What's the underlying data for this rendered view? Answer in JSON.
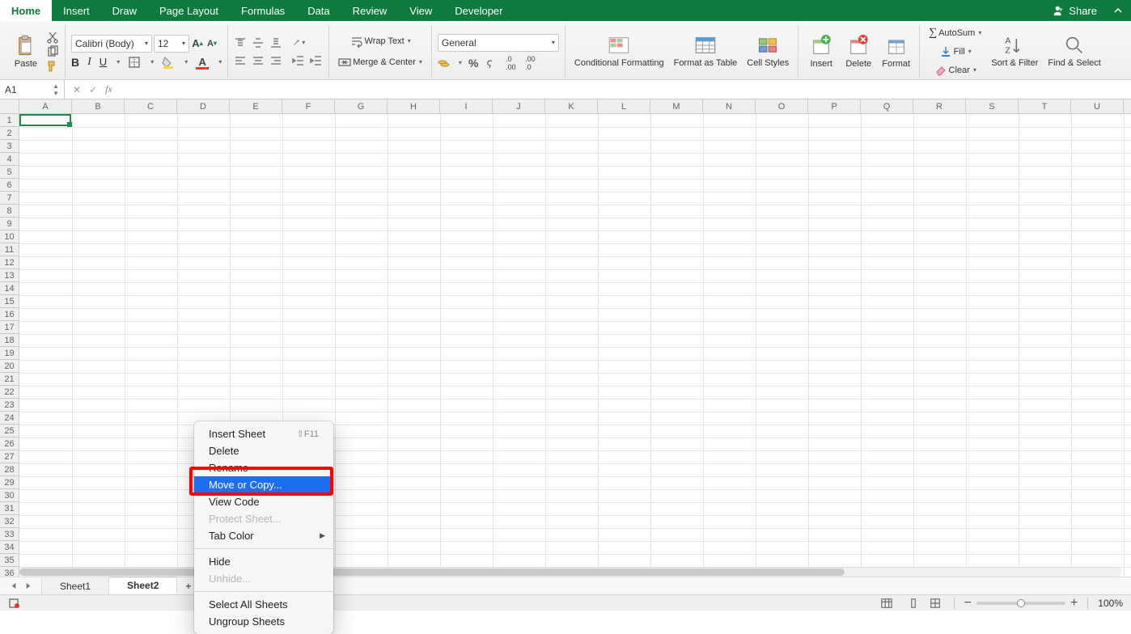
{
  "menubar": {
    "tabs": [
      "Home",
      "Insert",
      "Draw",
      "Page Layout",
      "Formulas",
      "Data",
      "Review",
      "View",
      "Developer"
    ],
    "active_tab": "Home",
    "share_label": "Share"
  },
  "ribbon": {
    "paste_label": "Paste",
    "font_name": "Calibri (Body)",
    "font_size": "12",
    "wrap_label": "Wrap Text",
    "merge_label": "Merge & Center",
    "number_format": "General",
    "cond_fmt": "Conditional Formatting",
    "fmt_table": "Format as Table",
    "cell_styles": "Cell Styles",
    "insert": "Insert",
    "delete": "Delete",
    "format": "Format",
    "autosum": "AutoSum",
    "fill": "Fill",
    "clear": "Clear",
    "sort_filter": "Sort & Filter",
    "find_select": "Find & Select"
  },
  "formula_bar": {
    "cell_ref": "A1",
    "formula": ""
  },
  "sheet": {
    "columns": [
      "A",
      "B",
      "C",
      "D",
      "E",
      "F",
      "G",
      "H",
      "I",
      "J",
      "K",
      "L",
      "M",
      "N",
      "O",
      "P",
      "Q",
      "R",
      "S",
      "T",
      "U"
    ],
    "row_count": 36
  },
  "tabs": {
    "sheets": [
      "Sheet1",
      "Sheet2"
    ],
    "active": "Sheet2"
  },
  "context_menu": {
    "items": [
      {
        "label": "Insert Sheet",
        "shortcut": "⇧F11"
      },
      {
        "label": "Delete"
      },
      {
        "label": "Rename"
      },
      {
        "label": "Move or Copy...",
        "highlighted": true
      },
      {
        "label": "View Code"
      },
      {
        "label": "Protect Sheet...",
        "disabled": true
      },
      {
        "label": "Tab Color",
        "submenu": true
      },
      {
        "sep": true
      },
      {
        "label": "Hide"
      },
      {
        "label": "Unhide...",
        "disabled": true
      },
      {
        "sep": true
      },
      {
        "label": "Select All Sheets"
      },
      {
        "label": "Ungroup Sheets"
      }
    ]
  },
  "status": {
    "zoom_pct": "100%"
  }
}
